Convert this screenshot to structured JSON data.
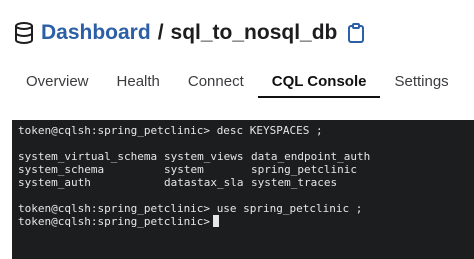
{
  "header": {
    "breadcrumb_root": "Dashboard",
    "separator": "/",
    "db_name": "sql_to_nosql_db"
  },
  "tabs": [
    {
      "label": "Overview",
      "active": false
    },
    {
      "label": "Health",
      "active": false
    },
    {
      "label": "Connect",
      "active": false
    },
    {
      "label": "CQL Console",
      "active": true
    },
    {
      "label": "Settings",
      "active": false
    }
  ],
  "console": {
    "prompt1": "token@cqlsh:spring_petclinic>",
    "command1": "desc KEYSPACES ;",
    "keyspaces": [
      [
        "system_virtual_schema",
        "system_views",
        "data_endpoint_auth"
      ],
      [
        "system_schema",
        "system",
        "spring_petclinic"
      ],
      [
        "system_auth",
        "datastax_sla",
        "system_traces"
      ]
    ],
    "prompt2": "token@cqlsh:spring_petclinic>",
    "command2": "use spring_petclinic ;",
    "prompt3": "token@cqlsh:spring_petclinic>"
  },
  "colors": {
    "accent": "#2c5fa6",
    "console_bg": "#1c1d1f",
    "console_text": "#e6e6e6"
  },
  "icons": {
    "database": "database-icon",
    "copy": "clipboard-icon"
  }
}
